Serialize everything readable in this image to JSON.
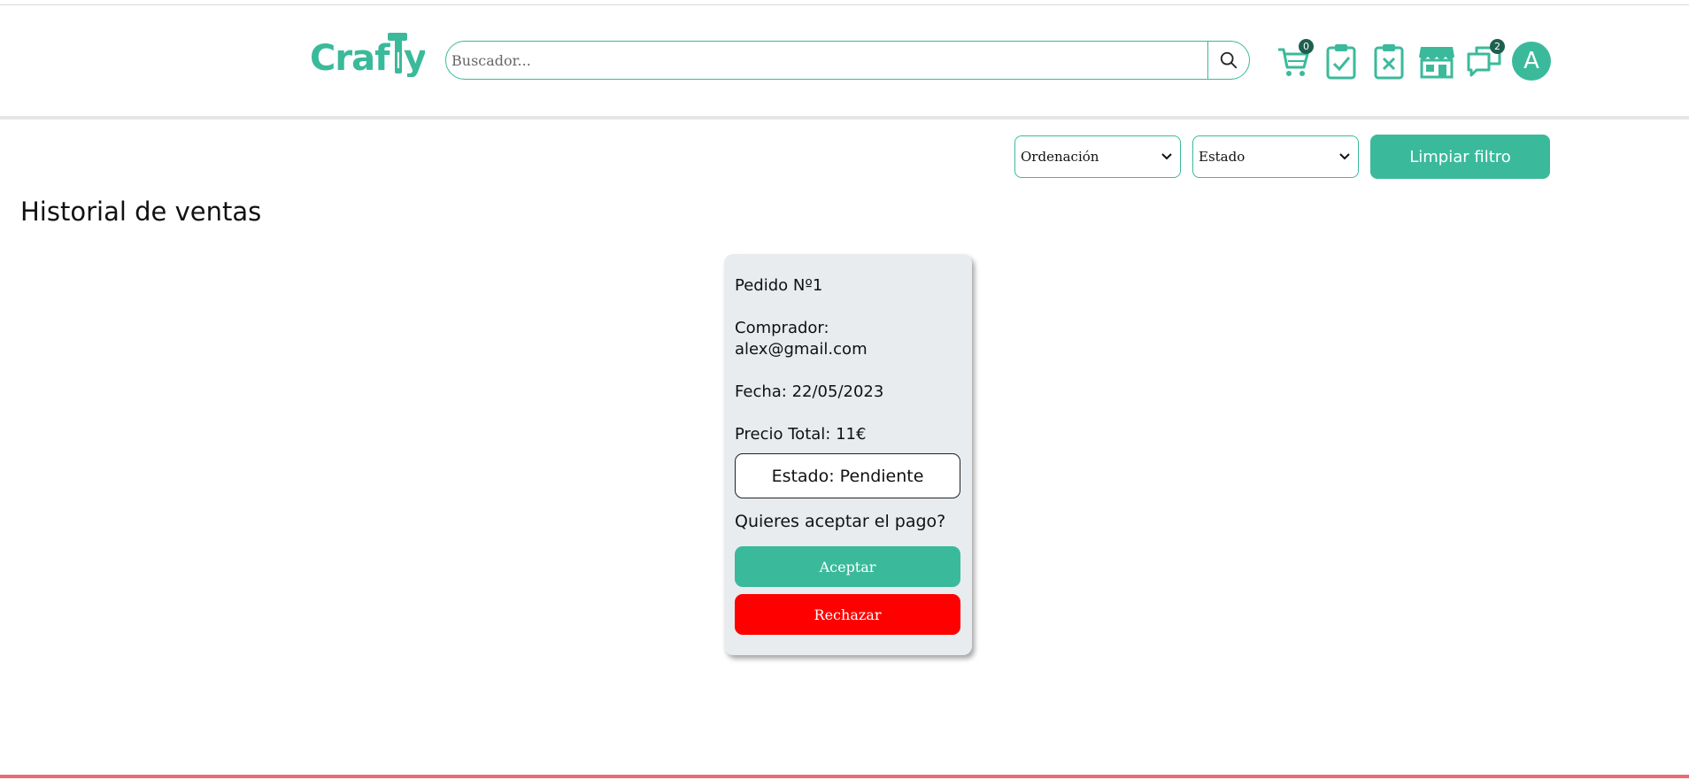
{
  "app": {
    "logo_text": "Crafty",
    "brand_color": "#3aba9b",
    "danger_color": "#ff0000",
    "bottom_bar_color": "#ea6b72"
  },
  "header": {
    "search": {
      "placeholder": "Buscador...",
      "value": ""
    },
    "icons": [
      {
        "name": "cart-icon",
        "badge": "0"
      },
      {
        "name": "clipboard-check-icon"
      },
      {
        "name": "clipboard-x-icon"
      },
      {
        "name": "store-icon"
      },
      {
        "name": "chat-icon",
        "badge": "2"
      }
    ],
    "avatar_initial": "A"
  },
  "filters": {
    "sort_select": "Ordenación",
    "status_select": "Estado",
    "clear_label": "Limpiar filtro"
  },
  "page_title": "Historial de ventas",
  "orders": [
    {
      "title": "Pedido Nº1",
      "buyer_label": "Comprador:",
      "buyer_email": "alex@gmail.com",
      "date": "Fecha: 22/05/2023",
      "total": "Precio Total: 11€",
      "status": "Estado: Pendiente",
      "question": "Quieres aceptar el pago?",
      "accept_label": "Aceptar",
      "reject_label": "Rechazar"
    }
  ]
}
